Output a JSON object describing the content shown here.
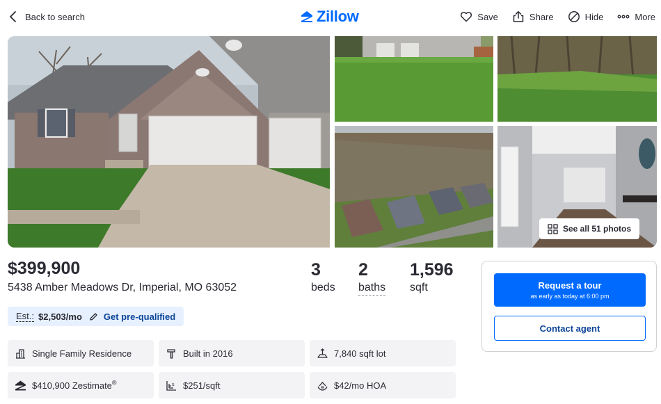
{
  "header": {
    "back_label": "Back to search",
    "logo_text": "Zillow",
    "actions": [
      {
        "label": "Save",
        "icon": "heart-icon"
      },
      {
        "label": "Share",
        "icon": "share-icon"
      },
      {
        "label": "Hide",
        "icon": "hide-icon"
      },
      {
        "label": "More",
        "icon": "more-icon"
      }
    ]
  },
  "gallery": {
    "see_all_label": "See all 51 photos"
  },
  "summary": {
    "price": "$399,900",
    "address": "5438 Amber Meadows Dr, Imperial, MO 63052",
    "beds_value": "3",
    "beds_label": "beds",
    "baths_value": "2",
    "baths_label": "baths",
    "sqft_value": "1,596",
    "sqft_label": "sqft",
    "estimate_label": "Est.:",
    "estimate_value": "$2,503/mo",
    "prequal_label": "Get pre-qualified"
  },
  "facts": {
    "type": "Single Family Residence",
    "built": "Built in 2016",
    "lot": "7,840 sqft lot",
    "zestimate": "$410,900 Zestimate",
    "zestimate_mark": "®",
    "price_per_sqft": "$251/sqft",
    "hoa": "$42/mo HOA"
  },
  "contact": {
    "tour_label": "Request a tour",
    "tour_sub": "as early as today at 6:00 pm",
    "contact_label": "Contact agent"
  },
  "colors": {
    "brand": "#006aff",
    "link": "#0d4599",
    "estimate_bg": "#e6f0ff",
    "fact_bg": "#f3f3f6"
  }
}
